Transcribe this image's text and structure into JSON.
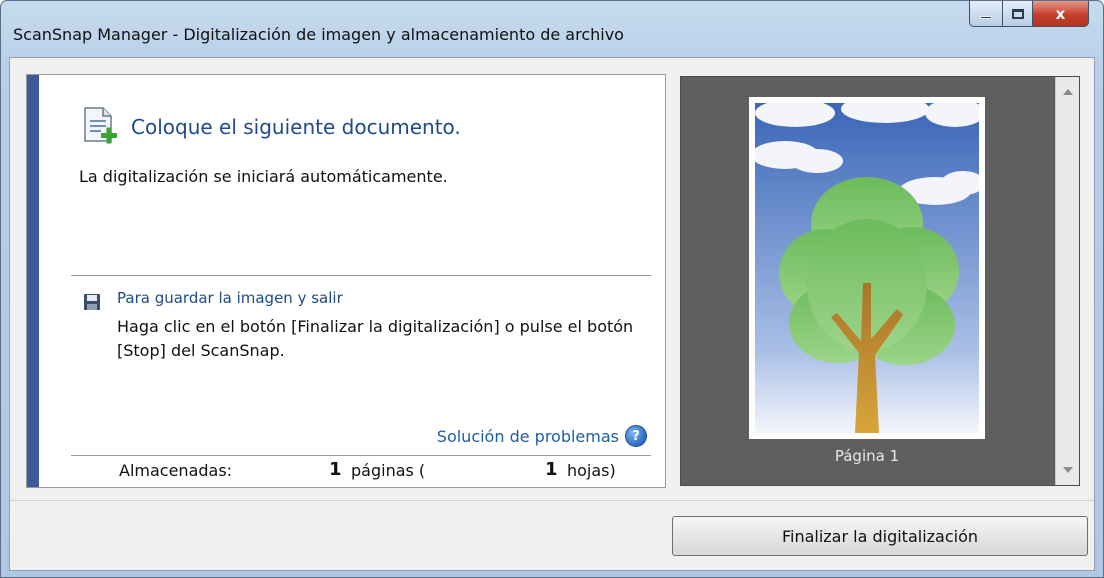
{
  "window": {
    "title": "ScanSnap Manager - Digitalización de imagen y almacenamiento de archivo",
    "close_glyph": "x"
  },
  "left_panel": {
    "heading": "Coloque el siguiente documento.",
    "auto_text": "La digitalización se iniciará automáticamente.",
    "save_section": {
      "title": "Para guardar la imagen y salir",
      "description": "Haga clic en el botón [Finalizar la digitalización] o pulse el botón [Stop] del ScanSnap."
    },
    "troubleshoot_link": "Solución de problemas",
    "help_glyph": "?",
    "stats": {
      "label": "Almacenadas:",
      "pages_count": "1",
      "pages_unit": "páginas (",
      "sheets_count": "1",
      "sheets_unit": "hojas)"
    }
  },
  "preview": {
    "page_label": "Página 1"
  },
  "footer": {
    "finish_button": "Finalizar la digitalización"
  },
  "colors": {
    "accent_bar": "#3f5a9a",
    "heading": "#1f4a8a",
    "link": "#1f5ea8",
    "close_button": "#c4412c"
  }
}
